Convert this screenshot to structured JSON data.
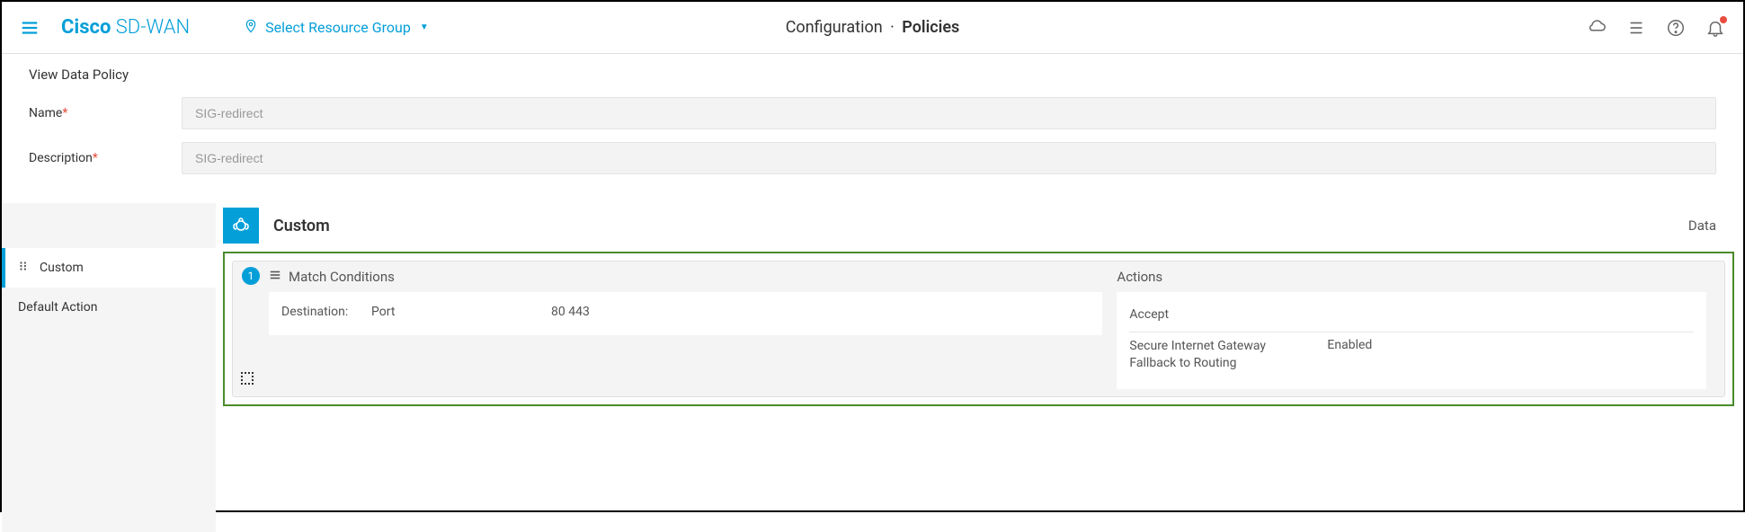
{
  "header": {
    "brand_bold": "Cisco",
    "brand_light": " SD-WAN",
    "resource_group_label": "Select Resource Group",
    "breadcrumb_section": "Configuration",
    "breadcrumb_page": "Policies"
  },
  "subheader": {
    "title": "View Data Policy"
  },
  "form": {
    "name_label": "Name",
    "name_value": "SIG-redirect",
    "desc_label": "Description",
    "desc_value": "SIG-redirect"
  },
  "sidebar": {
    "items": [
      {
        "label": "Custom",
        "active": true
      },
      {
        "label": "Default Action",
        "active": false
      }
    ]
  },
  "section": {
    "title": "Custom",
    "right_label": "Data"
  },
  "rule": {
    "index": "1",
    "match_heading": "Match Conditions",
    "actions_heading": "Actions",
    "match_rows": [
      {
        "label": "Destination:",
        "sublabel": "Port",
        "value": "80 443"
      }
    ],
    "action_rows": [
      {
        "key": "Accept",
        "value": ""
      },
      {
        "key": "Secure Internet Gateway\nFallback to Routing",
        "value": "Enabled"
      }
    ]
  }
}
